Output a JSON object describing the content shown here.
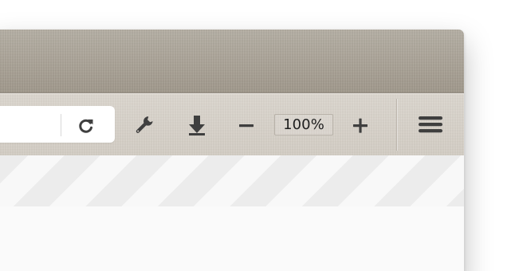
{
  "toolbar": {
    "reload_icon": "reload-icon",
    "wrench_icon": "wrench-icon",
    "download_icon": "download-arrow-icon",
    "zoom_out_icon": "minus-icon",
    "zoom_level": "100%",
    "zoom_in_icon": "plus-icon",
    "menu_icon": "hamburger-menu-icon"
  },
  "colors": {
    "tabstrip": "#aaa396",
    "toolbar": "#d7d1c9",
    "icon": "#3f3f3f",
    "content": "#fafafa",
    "stripe_dark": "#ececec",
    "stripe_light": "#f8f8f8"
  }
}
